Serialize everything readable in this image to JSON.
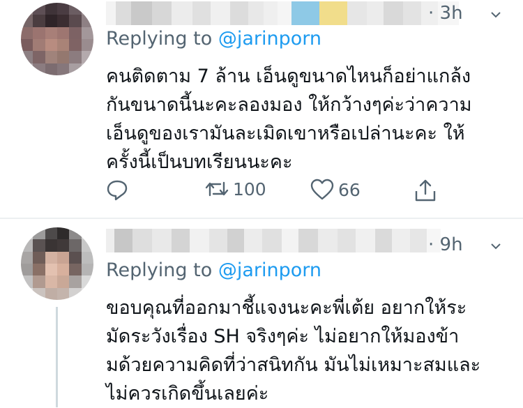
{
  "tweets": [
    {
      "time": "· 3h",
      "replying_prefix": "Replying to ",
      "replying_handle": "@jarinporn",
      "text": "คนติดตาม 7 ล้าน เอ็นดูขนาดไหนก็อย่าแกล้ง\nกันขนาดนี้นะคะลองมอง ให้กว้างๆค่ะว่าความ\nเอ็นดูของเรามันละเมิดเขาหรือเปล่านะคะ ให้\nครั้งนี้เป็นบทเรียนนะคะ",
      "retweets": "100",
      "likes": "66"
    },
    {
      "time": "· 9h",
      "replying_prefix": "Replying to ",
      "replying_handle": "@jarinporn",
      "text": "ขอบคุณที่ออกมาชี้แจงนะคะพี่เต้ย อยากให้ระ\nมัดระวังเรื่อง SH จริงๆค่ะ ไม่อยากให้มองข้า\nมด้วยความคิดที่ว่าสนิทกัน มันไม่เหมาะสมและ\nไม่ควรเกิดขึ้นเลยค่ะ"
    }
  ],
  "colors": {
    "secondary_text": "#536471",
    "link": "#1d9bf0",
    "primary_text": "#0f1419",
    "divider": "#eceff1"
  },
  "icons": [
    "reply-icon",
    "retweet-icon",
    "like-icon",
    "share-icon",
    "chevron-down-icon"
  ]
}
